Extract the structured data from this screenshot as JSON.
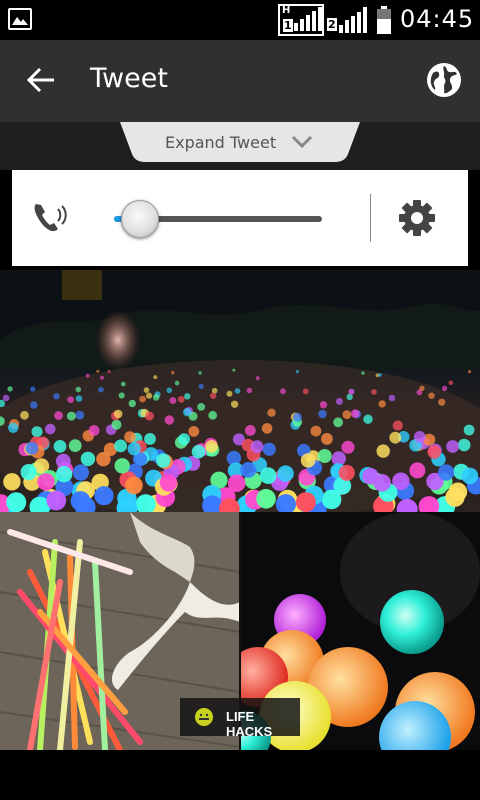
{
  "status_bar": {
    "time": "04:45",
    "sim1_network": "H",
    "sim1_label": "1",
    "sim2_label": "2",
    "battery_level": 0.6
  },
  "action_bar": {
    "title": "Tweet",
    "back_icon": "arrow-left-icon",
    "globe_icon": "globe-icon"
  },
  "expand": {
    "label": "Expand Tweet",
    "chevron_icon": "chevron-down-icon"
  },
  "volume": {
    "icon": "phone-speaker-icon",
    "level": 0.12,
    "settings_icon": "gear-icon",
    "accent_color": "#1e9be0"
  },
  "media": {
    "badge_label": "LIFE HACKS",
    "badge_icon": "lifehacks-logo-icon"
  }
}
